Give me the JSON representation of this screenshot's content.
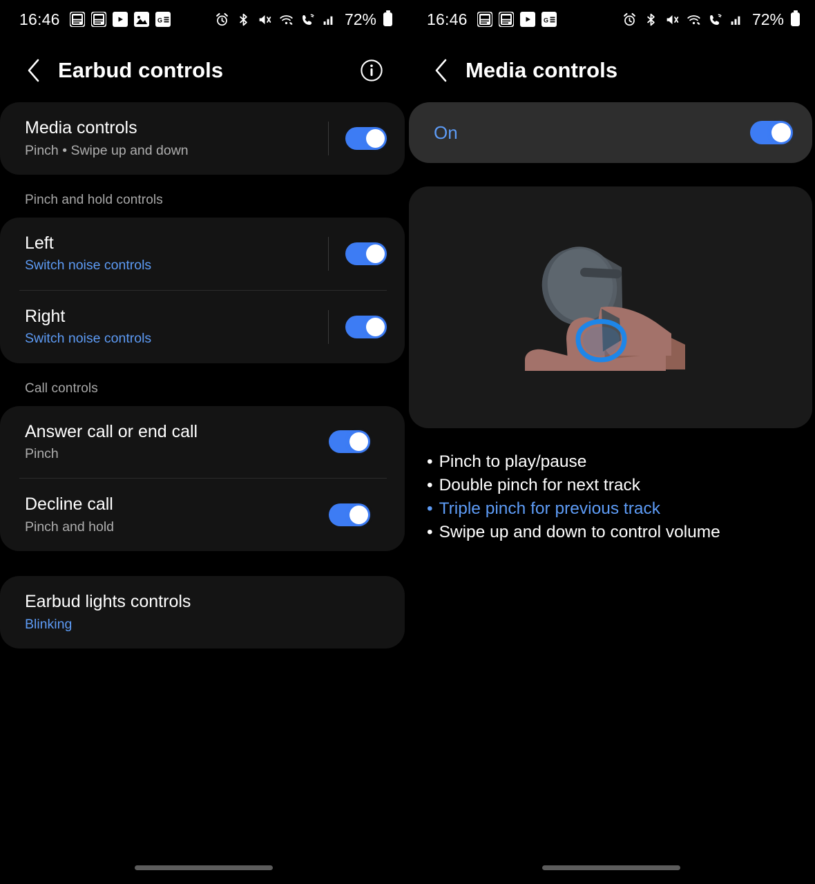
{
  "status_bar": {
    "time": "16:46",
    "battery_percent": "72%",
    "notification_icons_left": [
      "touchtodo-icon",
      "touchtodo-icon",
      "youtube-icon",
      "gallery-icon",
      "google-news-icon"
    ],
    "notification_icons_right": [
      "touchtodo-icon",
      "touchtodo-icon",
      "youtube-icon",
      "google-news-icon"
    ],
    "system_icons": [
      "alarm-icon",
      "bluetooth-icon",
      "mute-icon",
      "wifi-icon",
      "wifi-calling-icon",
      "signal-icon"
    ]
  },
  "left_pane": {
    "title": "Earbud controls",
    "back_icon": "chevron-left-icon",
    "info_icon": "info-icon",
    "media_controls": {
      "title": "Media controls",
      "subtitle": "Pinch • Swipe up and down",
      "toggle": "on"
    },
    "pinch_hold_section": {
      "label": "Pinch and hold controls",
      "rows": [
        {
          "title": "Left",
          "subtitle": "Switch noise controls",
          "toggle": "on"
        },
        {
          "title": "Right",
          "subtitle": "Switch noise controls",
          "toggle": "on"
        }
      ]
    },
    "call_section": {
      "label": "Call controls",
      "rows": [
        {
          "title": "Answer call or end call",
          "subtitle": "Pinch",
          "toggle": "on"
        },
        {
          "title": "Decline call",
          "subtitle": "Pinch and hold",
          "toggle": "on"
        }
      ]
    },
    "lights": {
      "title": "Earbud lights controls",
      "subtitle": "Blinking"
    }
  },
  "right_pane": {
    "title": "Media controls",
    "back_icon": "chevron-left-icon",
    "master_toggle": {
      "label": "On",
      "toggle": "on"
    },
    "illustration": "pinch-earbud-illustration",
    "bullets": [
      {
        "text": "Pinch to play/pause",
        "highlight": false
      },
      {
        "text": "Double pinch for next track",
        "highlight": false
      },
      {
        "text": "Triple pinch for previous track",
        "highlight": true
      },
      {
        "text": "Swipe up and down to control volume",
        "highlight": false
      }
    ]
  },
  "colors": {
    "accent_blue": "#3d7cf4",
    "link_blue": "#5d9bf5",
    "card_bg": "#141414",
    "on_card_bg": "#2e2e2e",
    "background": "#000000"
  }
}
